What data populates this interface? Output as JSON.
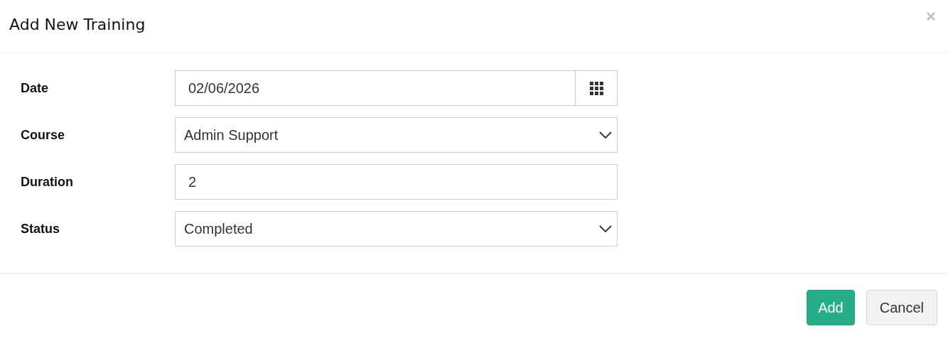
{
  "dialog": {
    "title": "Add New Training"
  },
  "fields": [
    {
      "kind": "date",
      "label": "Date",
      "value": "02/06/2026"
    },
    {
      "kind": "select",
      "label": "Course",
      "value": "Admin Support"
    },
    {
      "kind": "text",
      "label": "Duration",
      "value": "2"
    },
    {
      "kind": "select",
      "label": "Status",
      "value": "Completed"
    }
  ],
  "buttons": [
    {
      "kind": "primary",
      "label": "Add"
    },
    {
      "kind": "default",
      "label": "Cancel"
    }
  ]
}
